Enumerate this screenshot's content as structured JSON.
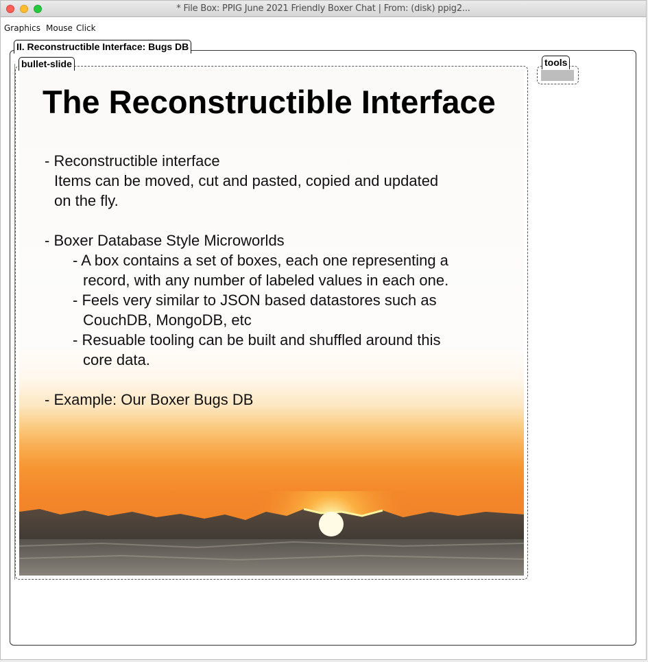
{
  "window": {
    "title": "* File Box: PPIG June 2021 Friendly Boxer Chat | From: (disk) ppig2..."
  },
  "menubar": {
    "items": [
      "Graphics",
      "Mouse",
      "Click"
    ]
  },
  "outer_box": {
    "name": "II. Reconstructible Interface: Bugs DB"
  },
  "slide_box": {
    "name": "bullet-slide"
  },
  "tools_box": {
    "name": "tools"
  },
  "slide": {
    "title": "The Reconstructible Interface",
    "lines": [
      "- Reconstructible interface",
      "Items can be moved, cut and pasted, copied and updated",
      "on the fly.",
      "- Boxer Database Style Microworlds",
      "- A box contains a set of boxes, each one representing a",
      "record, with any number of labeled values in each one.",
      "- Feels very similar to JSON based datastores such as",
      "CouchDB, MongoDB, etc",
      "- Resuable tooling can be built and shuffled around this",
      "core data.",
      "- Example: Our Boxer Bugs DB"
    ]
  },
  "colors": {
    "sky_top": "#fbfaf8",
    "sunset_orange": "#ef7b24",
    "sun": "#fff6c8",
    "clouds": "#3e3a33",
    "close": "#fe5f57",
    "minimize": "#febc2e",
    "zoom": "#28c840"
  }
}
